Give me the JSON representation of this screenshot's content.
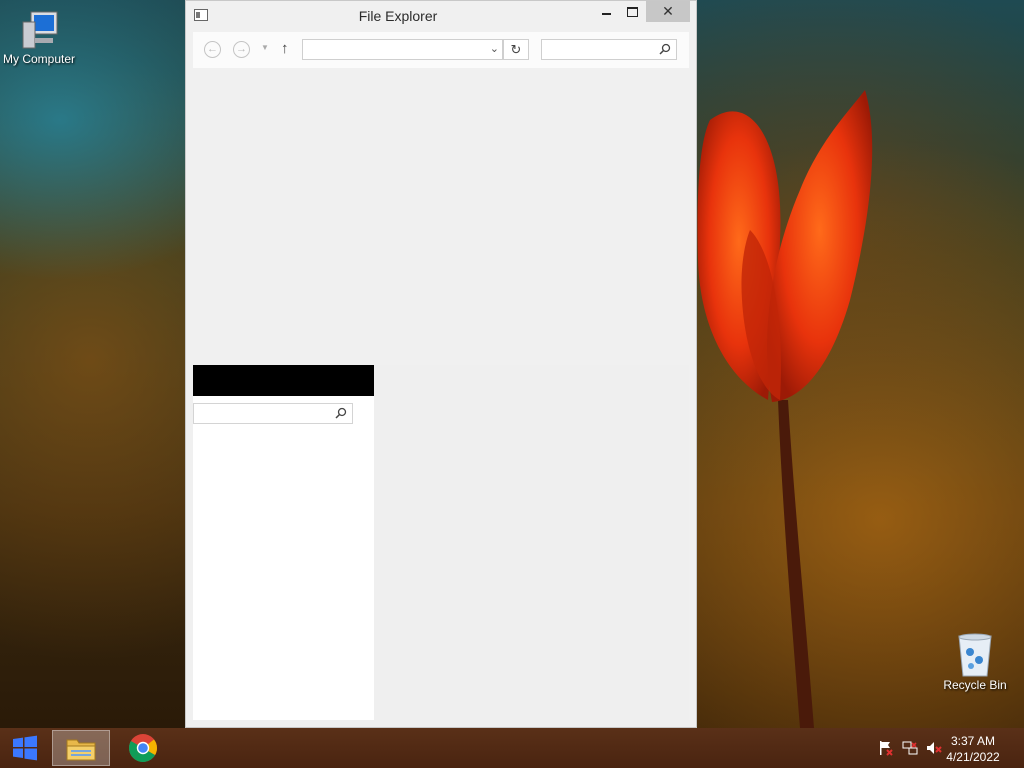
{
  "desktop": {
    "icons": [
      {
        "label": "My Computer"
      },
      {
        "label": "Recycle Bin"
      }
    ]
  },
  "window": {
    "title": "File Explorer",
    "buttons": {
      "minimize": "minimize-icon",
      "maximize": "maximize-icon",
      "close": "close-icon"
    },
    "navbar": {
      "back": "back-arrow-icon",
      "forward": "forward-arrow-icon",
      "up": "up-arrow-icon",
      "address_value": "",
      "search_value": ""
    },
    "left_pane": {
      "search_value": ""
    }
  },
  "taskbar": {
    "start": "windows-logo-icon",
    "pinned": [
      "file-explorer-icon",
      "chrome-icon"
    ],
    "tray": [
      "action-center-flag-icon",
      "network-icon",
      "volume-muted-icon"
    ],
    "clock": {
      "time": "3:37 AM",
      "date": "4/21/2022"
    }
  },
  "colors": {
    "window_bg": "#f0f0f0",
    "close_button": "#c7c7c7",
    "taskbar": "#4a2410",
    "start_logo": "#3b78ff"
  }
}
